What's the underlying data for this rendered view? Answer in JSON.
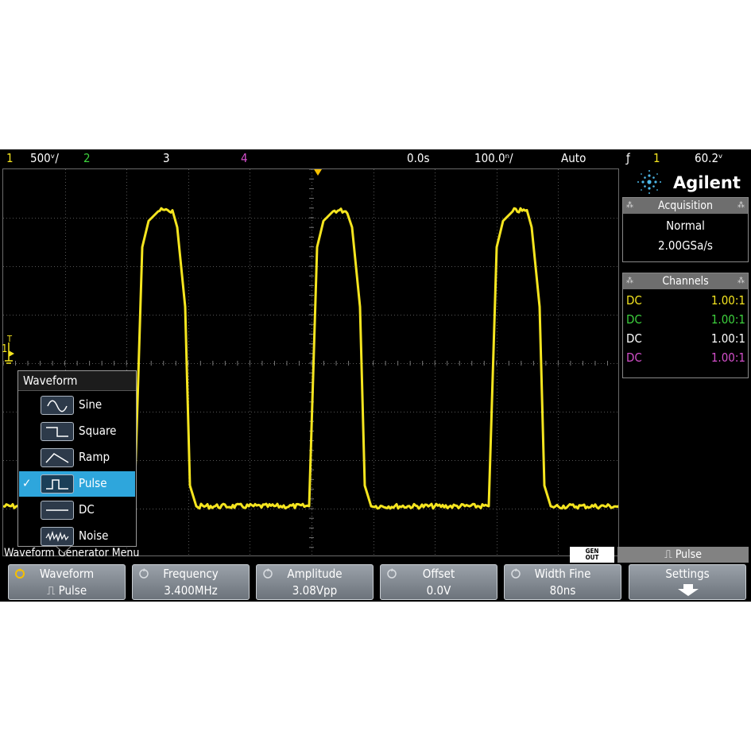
{
  "status_bar": {
    "ch1_label": "1",
    "ch1_scale": "500ᵛ/",
    "ch2_label": "2",
    "ch3_label": "3",
    "ch4_label": "4",
    "delay": "0.0s",
    "timebase": "100.0ⁿ/",
    "trigger_mode": "Auto",
    "trigger_icon": "ƒ",
    "trigger_source": "1",
    "trigger_level": "60.2ᵛ"
  },
  "colors": {
    "ch1": "#f5e51f",
    "ch2": "#3dd13d",
    "ch3": "#ffffff",
    "ch4": "#d44fcb",
    "selection": "#2ea6dc",
    "trigger_marker": "#f5c000"
  },
  "brand": {
    "name": "Agilent"
  },
  "acquisition": {
    "title": "Acquisition",
    "mode": "Normal",
    "rate": "2.00GSa/s"
  },
  "channels_panel": {
    "title": "Channels",
    "rows": [
      {
        "coupling": "DC",
        "probe": "1.00:1"
      },
      {
        "coupling": "DC",
        "probe": "1.00:1"
      },
      {
        "coupling": "DC",
        "probe": "1.00:1"
      },
      {
        "coupling": "DC",
        "probe": "1.00:1"
      }
    ]
  },
  "ground_marker": {
    "label": "1",
    "trigger_letter": "T"
  },
  "waveform_popup": {
    "title": "Waveform",
    "items": [
      {
        "label": "Sine",
        "icon": "sine-icon",
        "selected": false
      },
      {
        "label": "Square",
        "icon": "square-wave-icon",
        "selected": false
      },
      {
        "label": "Ramp",
        "icon": "ramp-icon",
        "selected": false
      },
      {
        "label": "Pulse",
        "icon": "pulse-icon",
        "selected": true
      },
      {
        "label": "DC",
        "icon": "dc-icon",
        "selected": false
      },
      {
        "label": "Noise",
        "icon": "noise-icon",
        "selected": false
      }
    ],
    "check_mark": "✓"
  },
  "menu_label": "Waveform Generator Menu",
  "gen_out": {
    "line1": "GEN",
    "line2": "OUT"
  },
  "gen_status": "⎍ Pulse",
  "softkeys": [
    {
      "title": "Waveform",
      "value": "⎍ Pulse"
    },
    {
      "title": "Frequency",
      "value": "3.400MHz"
    },
    {
      "title": "Amplitude",
      "value": "3.08Vpp"
    },
    {
      "title": "Offset",
      "value": "0.0V"
    },
    {
      "title": "Width Fine",
      "value": "80ns"
    },
    {
      "title": "Settings",
      "value": ""
    }
  ]
}
